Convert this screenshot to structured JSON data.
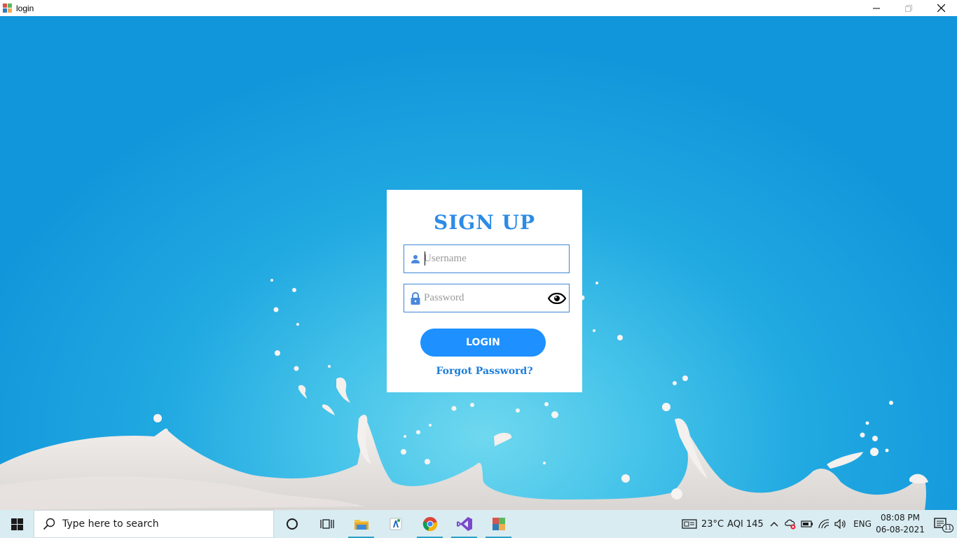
{
  "window": {
    "title": "login"
  },
  "form": {
    "heading": "SIGN UP",
    "username_placeholder": "Username",
    "password_placeholder": "Password",
    "login_label": "LOGIN",
    "forgot_label": "Forgot Password?"
  },
  "taskbar": {
    "search_placeholder": "Type here to search",
    "apps": [
      "task-view",
      "file-explorer",
      "app-launcher",
      "chrome",
      "visual-studio",
      "winforms-app"
    ],
    "weather": "23°C",
    "aqi": "AQI 145",
    "language": "ENG",
    "time": "08:08 PM",
    "date": "06-08-2021",
    "notification_count": "11"
  },
  "colors": {
    "accent": "#1e90ff",
    "heading": "#2c8be6",
    "background": "#1a9fde"
  }
}
